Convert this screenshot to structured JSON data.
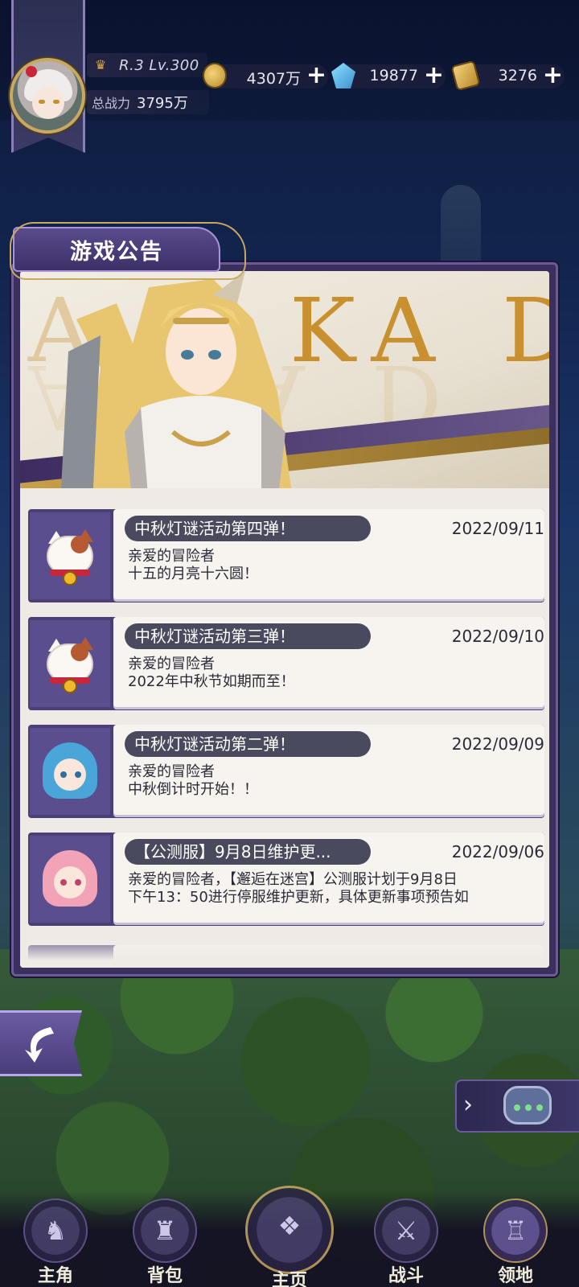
{
  "header": {
    "rank": "R.3 Lv.300",
    "power_label": "总战力",
    "power_value": "3795万",
    "currencies": [
      {
        "name": "gold",
        "icon": "coin-icon",
        "value": "4307万"
      },
      {
        "name": "gem",
        "icon": "gem-icon",
        "value": "19877"
      },
      {
        "name": "ticket",
        "icon": "ticket-icon",
        "value": "3276"
      }
    ],
    "plus_symbol": "+"
  },
  "notice_panel": {
    "title": "游戏公告",
    "banner_text": "A KA D",
    "banner_text_faded": "A"
  },
  "notices": [
    {
      "title": "中秋灯谜活动第四弹！",
      "date": "2022/09/11",
      "line1": "亲爱的冒险者",
      "line2": "十五的月亮十六圆！",
      "avatar": "lucky-cat"
    },
    {
      "title": "中秋灯谜活动第三弹！",
      "date": "2022/09/10",
      "line1": "亲爱的冒险者",
      "line2": "2022年中秋节如期而至！",
      "avatar": "lucky-cat"
    },
    {
      "title": "中秋灯谜活动第二弹！",
      "date": "2022/09/09",
      "line1": "亲爱的冒险者",
      "line2": "中秋倒计时开始！！",
      "avatar": "blue-hair-girl"
    },
    {
      "title": "【公测服】9月8日维护更...",
      "date": "2022/09/06",
      "line1": "亲爱的冒险者，【邂逅在迷宫】公测服计划于9月8日",
      "line2": "下午13：50进行停服维护更新，具体更新事项预告如",
      "avatar": "pink-hair-girl"
    }
  ],
  "nav": {
    "items": [
      {
        "label": "主角",
        "icon": "hero-icon"
      },
      {
        "label": "背包",
        "icon": "bag-icon"
      },
      {
        "label": "主页",
        "icon": "book-icon"
      },
      {
        "label": "战斗",
        "icon": "swords-icon"
      },
      {
        "label": "领地",
        "icon": "castle-icon"
      }
    ]
  },
  "side": {
    "back_icon": "back-arrow-icon",
    "chat_icon": "chat-icon",
    "chevron": "›"
  },
  "colors": {
    "panel_bg": "#3a2f5d",
    "card_bg": "#f7f4ef",
    "pill_bg": "#4a4a5e",
    "gold": "#c9a862"
  }
}
